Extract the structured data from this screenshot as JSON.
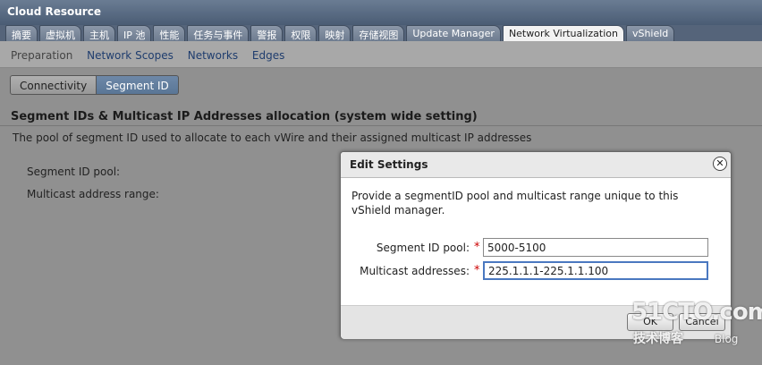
{
  "window": {
    "title": "Cloud Resource"
  },
  "tabs": [
    {
      "label": "摘要"
    },
    {
      "label": "虚拟机"
    },
    {
      "label": "主机"
    },
    {
      "label": "IP 池"
    },
    {
      "label": "性能"
    },
    {
      "label": "任务与事件"
    },
    {
      "label": "警报"
    },
    {
      "label": "权限"
    },
    {
      "label": "映射"
    },
    {
      "label": "存储视图"
    },
    {
      "label": "Update Manager"
    },
    {
      "label": "Network Virtualization"
    },
    {
      "label": "vShield"
    }
  ],
  "subnav": [
    {
      "label": "Preparation"
    },
    {
      "label": "Network Scopes"
    },
    {
      "label": "Networks"
    },
    {
      "label": "Edges"
    }
  ],
  "segmented": {
    "connectivity": "Connectivity",
    "segment_id": "Segment ID"
  },
  "section": {
    "title": "Segment IDs & Multicast IP Addresses allocation (system wide setting)",
    "description": "The pool of segment ID used to allocate to each vWire and their assigned multicast IP addresses",
    "segment_pool_label": "Segment ID pool:",
    "multicast_range_label": "Multicast address range:"
  },
  "dialog": {
    "title": "Edit Settings",
    "close_icon": "close-icon",
    "message": "Provide a segmentID pool and multicast range unique to this vShield manager.",
    "required_mark": "*",
    "fields": {
      "segment_label": "Segment ID pool:",
      "segment_value": "5000-5100",
      "multicast_label": "Multicast addresses:",
      "multicast_value": "225.1.1.1-225.1.1.100"
    },
    "ok_label": "OK",
    "cancel_label": "Cancel"
  },
  "watermark": {
    "line1": "51CTO.com",
    "line2": "技术博客",
    "line3": "Blog"
  },
  "colors": {
    "accent": "#4a78c0",
    "required": "#cc0000",
    "tab_bar": "#55647a"
  }
}
